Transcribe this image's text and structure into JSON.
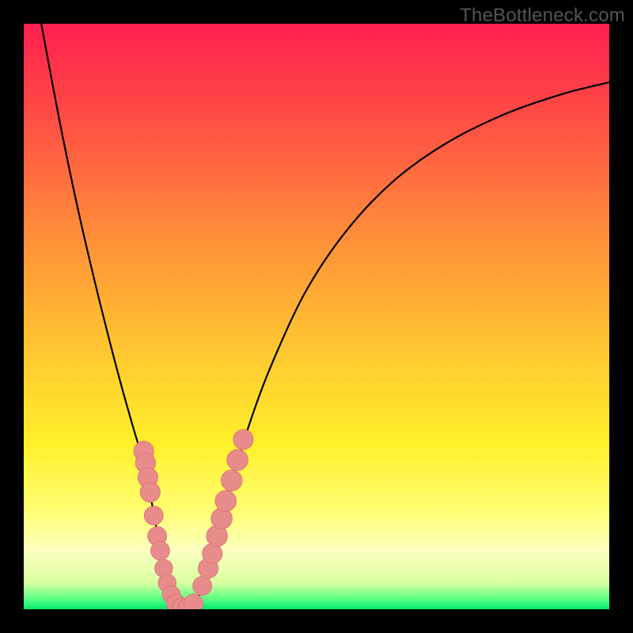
{
  "watermark": "TheBottleneck.com",
  "colors": {
    "background": "#000000",
    "gradient_stops": [
      {
        "offset": 0.0,
        "color": "#ff1f4f"
      },
      {
        "offset": 0.15,
        "color": "#ff4a45"
      },
      {
        "offset": 0.35,
        "color": "#ff8a3a"
      },
      {
        "offset": 0.55,
        "color": "#ffc531"
      },
      {
        "offset": 0.72,
        "color": "#fff02a"
      },
      {
        "offset": 0.84,
        "color": "#ffff7a"
      },
      {
        "offset": 0.9,
        "color": "#fbffc0"
      },
      {
        "offset": 0.955,
        "color": "#d8ffa0"
      },
      {
        "offset": 0.985,
        "color": "#4dff82"
      },
      {
        "offset": 1.0,
        "color": "#00e86a"
      }
    ],
    "curve": "#000000",
    "marker_fill": "#e88b8b",
    "marker_stroke": "#d97272",
    "watermark": "#555555"
  },
  "chart_data": {
    "type": "line",
    "title": "",
    "xlabel": "",
    "ylabel": "",
    "xlim": [
      0,
      100
    ],
    "ylim": [
      0,
      100
    ],
    "grid": false,
    "curve_left": [
      {
        "x": 3.0,
        "y": 100.0
      },
      {
        "x": 6.0,
        "y": 84.0
      },
      {
        "x": 9.0,
        "y": 69.5
      },
      {
        "x": 12.0,
        "y": 56.5
      },
      {
        "x": 15.0,
        "y": 44.5
      },
      {
        "x": 17.0,
        "y": 37.0
      },
      {
        "x": 19.0,
        "y": 30.0
      },
      {
        "x": 20.5,
        "y": 25.0
      },
      {
        "x": 22.0,
        "y": 17.5
      },
      {
        "x": 23.0,
        "y": 12.0
      },
      {
        "x": 24.0,
        "y": 7.5
      },
      {
        "x": 25.0,
        "y": 3.5
      },
      {
        "x": 26.0,
        "y": 1.0
      },
      {
        "x": 27.0,
        "y": 0.0
      }
    ],
    "curve_right": [
      {
        "x": 27.0,
        "y": 0.0
      },
      {
        "x": 28.0,
        "y": 0.0
      },
      {
        "x": 29.5,
        "y": 1.5
      },
      {
        "x": 31.0,
        "y": 5.0
      },
      {
        "x": 33.0,
        "y": 12.0
      },
      {
        "x": 35.0,
        "y": 20.0
      },
      {
        "x": 38.0,
        "y": 30.0
      },
      {
        "x": 42.0,
        "y": 41.0
      },
      {
        "x": 48.0,
        "y": 54.0
      },
      {
        "x": 55.0,
        "y": 64.5
      },
      {
        "x": 63.0,
        "y": 73.0
      },
      {
        "x": 72.0,
        "y": 79.5
      },
      {
        "x": 82.0,
        "y": 84.5
      },
      {
        "x": 92.0,
        "y": 88.0
      },
      {
        "x": 100.0,
        "y": 90.0
      }
    ],
    "markers": [
      {
        "x": 20.5,
        "y": 27.0,
        "r": 1.3
      },
      {
        "x": 20.8,
        "y": 25.0,
        "r": 1.3
      },
      {
        "x": 21.2,
        "y": 22.5,
        "r": 1.3
      },
      {
        "x": 21.6,
        "y": 20.0,
        "r": 1.3
      },
      {
        "x": 22.2,
        "y": 16.0,
        "r": 1.2
      },
      {
        "x": 22.8,
        "y": 12.5,
        "r": 1.2
      },
      {
        "x": 23.3,
        "y": 10.0,
        "r": 1.2
      },
      {
        "x": 23.9,
        "y": 7.0,
        "r": 1.1
      },
      {
        "x": 24.5,
        "y": 4.5,
        "r": 1.1
      },
      {
        "x": 25.2,
        "y": 2.5,
        "r": 1.1
      },
      {
        "x": 26.0,
        "y": 1.0,
        "r": 1.2
      },
      {
        "x": 27.0,
        "y": 0.3,
        "r": 1.2
      },
      {
        "x": 28.0,
        "y": 0.3,
        "r": 1.2
      },
      {
        "x": 29.0,
        "y": 1.0,
        "r": 1.2
      },
      {
        "x": 30.5,
        "y": 4.0,
        "r": 1.2
      },
      {
        "x": 31.5,
        "y": 7.0,
        "r": 1.3
      },
      {
        "x": 32.2,
        "y": 9.5,
        "r": 1.3
      },
      {
        "x": 33.0,
        "y": 12.5,
        "r": 1.4
      },
      {
        "x": 33.8,
        "y": 15.5,
        "r": 1.4
      },
      {
        "x": 34.5,
        "y": 18.5,
        "r": 1.4
      },
      {
        "x": 35.5,
        "y": 22.0,
        "r": 1.4
      },
      {
        "x": 36.5,
        "y": 25.5,
        "r": 1.4
      },
      {
        "x": 37.5,
        "y": 29.0,
        "r": 1.3
      }
    ]
  }
}
